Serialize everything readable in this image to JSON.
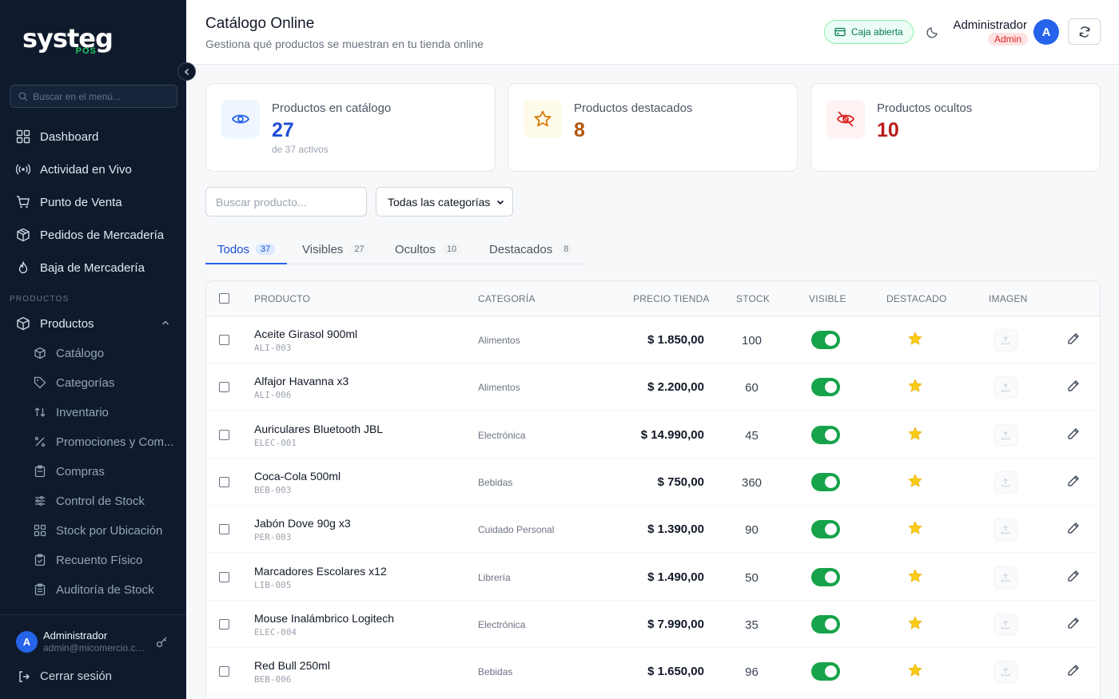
{
  "sidebar": {
    "logo_name": "systeg",
    "logo_sub": "POS",
    "search_placeholder": "Buscar en el menú...",
    "nav": [
      {
        "label": "Dashboard",
        "icon": "grid-icon"
      },
      {
        "label": "Actividad en Vivo",
        "icon": "broadcast-icon"
      },
      {
        "label": "Punto de Venta",
        "icon": "cart-icon"
      },
      {
        "label": "Pedidos de Mercadería",
        "icon": "package-icon"
      },
      {
        "label": "Baja de Mercadería",
        "icon": "flame-icon"
      }
    ],
    "section_label": "PRODUCTOS",
    "products_label": "Productos",
    "sub_items": [
      {
        "label": "Catálogo",
        "icon": "cube-icon"
      },
      {
        "label": "Categorías",
        "icon": "tag-icon"
      },
      {
        "label": "Inventario",
        "icon": "sort-icon"
      },
      {
        "label": "Promociones y Com...",
        "icon": "percent-icon"
      },
      {
        "label": "Compras",
        "icon": "clipboard-icon"
      },
      {
        "label": "Control de Stock",
        "icon": "sliders-icon"
      },
      {
        "label": "Stock por Ubicación",
        "icon": "grid-icon"
      },
      {
        "label": "Recuento Físico",
        "icon": "clipboard-check-icon"
      },
      {
        "label": "Auditoría de Stock",
        "icon": "clipboard-list-icon"
      }
    ],
    "user": {
      "initial": "A",
      "name": "Administrador",
      "email": "admin@micomercio.com"
    },
    "logout_label": "Cerrar sesión"
  },
  "header": {
    "title": "Catálogo Online",
    "subtitle": "Gestiona qué productos se muestran en tu tienda online",
    "cash_status": "Caja abierta",
    "user_name": "Administrador",
    "user_role": "Admin",
    "avatar_initial": "A"
  },
  "stats": [
    {
      "label": "Productos en catálogo",
      "value": "27",
      "sub": "de 37 activos",
      "color": "#1d4ed8",
      "icon": "eye-icon"
    },
    {
      "label": "Productos destacados",
      "value": "8",
      "sub": "",
      "color": "#b45309",
      "icon": "star-icon"
    },
    {
      "label": "Productos ocultos",
      "value": "10",
      "sub": "",
      "color": "#b91c1c",
      "icon": "eye-off-icon"
    }
  ],
  "filters": {
    "search_placeholder": "Buscar producto...",
    "category_selected": "Todas las categorías"
  },
  "tabs": [
    {
      "label": "Todos",
      "count": "37"
    },
    {
      "label": "Visibles",
      "count": "27"
    },
    {
      "label": "Ocultos",
      "count": "10"
    },
    {
      "label": "Destacados",
      "count": "8"
    }
  ],
  "table": {
    "headers": [
      "PRODUCTO",
      "CATEGORÍA",
      "PRECIO TIENDA",
      "STOCK",
      "VISIBLE",
      "DESTACADO",
      "IMAGEN"
    ],
    "rows": [
      {
        "name": "Aceite Girasol 900ml",
        "sku": "ALI-003",
        "category": "Alimentos",
        "price": "$ 1.850,00",
        "stock": "100"
      },
      {
        "name": "Alfajor Havanna x3",
        "sku": "ALI-006",
        "category": "Alimentos",
        "price": "$ 2.200,00",
        "stock": "60"
      },
      {
        "name": "Auriculares Bluetooth JBL",
        "sku": "ELEC-001",
        "category": "Electrónica",
        "price": "$ 14.990,00",
        "stock": "45"
      },
      {
        "name": "Coca-Cola 500ml",
        "sku": "BEB-003",
        "category": "Bebidas",
        "price": "$ 750,00",
        "stock": "360"
      },
      {
        "name": "Jabón Dove 90g x3",
        "sku": "PER-003",
        "category": "Cuidado Personal",
        "price": "$ 1.390,00",
        "stock": "90"
      },
      {
        "name": "Marcadores Escolares x12",
        "sku": "LIB-005",
        "category": "Librería",
        "price": "$ 1.490,00",
        "stock": "50"
      },
      {
        "name": "Mouse Inalámbrico Logitech",
        "sku": "ELEC-004",
        "category": "Electrónica",
        "price": "$ 7.990,00",
        "stock": "35"
      },
      {
        "name": "Red Bull 250ml",
        "sku": "BEB-006",
        "category": "Bebidas",
        "price": "$ 1.650,00",
        "stock": "96"
      }
    ]
  }
}
